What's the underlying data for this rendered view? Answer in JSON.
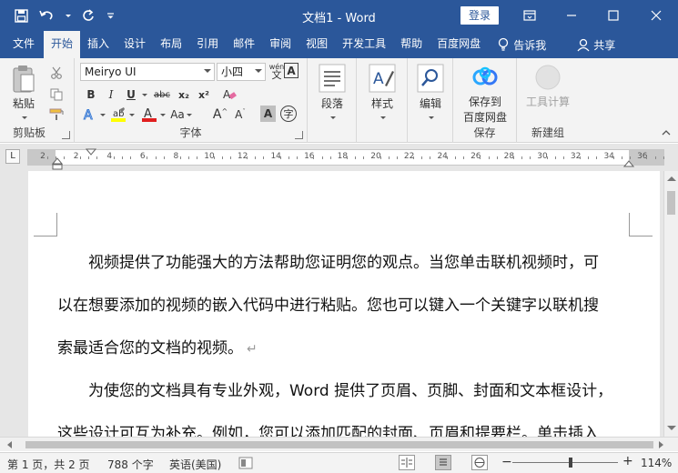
{
  "window": {
    "title": "文档1 - Word",
    "login_label": "登录"
  },
  "qat": {
    "save_icon": "save-icon",
    "undo_icon": "undo-icon",
    "redo_icon": "redo-icon",
    "customize_icon": "customize-qat-icon"
  },
  "tabs": [
    {
      "label": "文件"
    },
    {
      "label": "开始",
      "active": true
    },
    {
      "label": "插入"
    },
    {
      "label": "设计"
    },
    {
      "label": "布局"
    },
    {
      "label": "引用"
    },
    {
      "label": "邮件"
    },
    {
      "label": "审阅"
    },
    {
      "label": "视图"
    },
    {
      "label": "开发工具"
    },
    {
      "label": "帮助"
    },
    {
      "label": "百度网盘"
    }
  ],
  "tell_me": "告诉我",
  "share": "共享",
  "ribbon": {
    "clipboard": {
      "label": "剪贴板",
      "paste_label": "粘贴"
    },
    "font": {
      "label": "字体",
      "font_name": "Meiryo UI",
      "font_size": "小四",
      "bold": "B",
      "italic": "I",
      "underline": "U",
      "strike": "abc",
      "subscript": "x₂",
      "superscript": "x²",
      "grow": "A",
      "shrink": "A",
      "change_case": "Aa",
      "char_shading": "A",
      "enclose": "字"
    },
    "paragraph": {
      "label": "段落"
    },
    "styles": {
      "label": "样式"
    },
    "editing": {
      "label": "编辑"
    },
    "save": {
      "label": "保存",
      "button_line1": "保存到",
      "button_line2": "百度网盘"
    },
    "newgroup": {
      "label": "新建组",
      "button_label": "工具计算"
    }
  },
  "ruler": {
    "corner": "L",
    "numbers": [
      "2",
      "2",
      "4",
      "6",
      "8",
      "10",
      "12",
      "14",
      "16",
      "18",
      "20",
      "22",
      "24",
      "26",
      "28",
      "30",
      "32",
      "34",
      "36"
    ]
  },
  "document": {
    "paragraphs": [
      {
        "lines": [
          "　　视频提供了功能强大的方法帮助您证明您的观点。当您单击联机视频时，可",
          "以在想要添加的视频的嵌入代码中进行粘贴。您也可以键入一个关键字以联机搜",
          "索最适合您的文档的视频。"
        ]
      },
      {
        "lines": [
          "　　为使您的文档具有专业外观，Word 提供了页眉、页脚、封面和文本框设计，",
          "这些设计可互为补充。例如，您可以添加匹配的封面、页眉和提要栏。单击插入"
        ]
      }
    ],
    "paragraph_mark": "↵"
  },
  "status": {
    "page": "第 1 页，共 2 页",
    "words": "788 个字",
    "language": "英语(美国)",
    "zoom": "114%",
    "zoom_minus": "−",
    "zoom_plus": "+",
    "zoom_fraction": 0.55
  }
}
